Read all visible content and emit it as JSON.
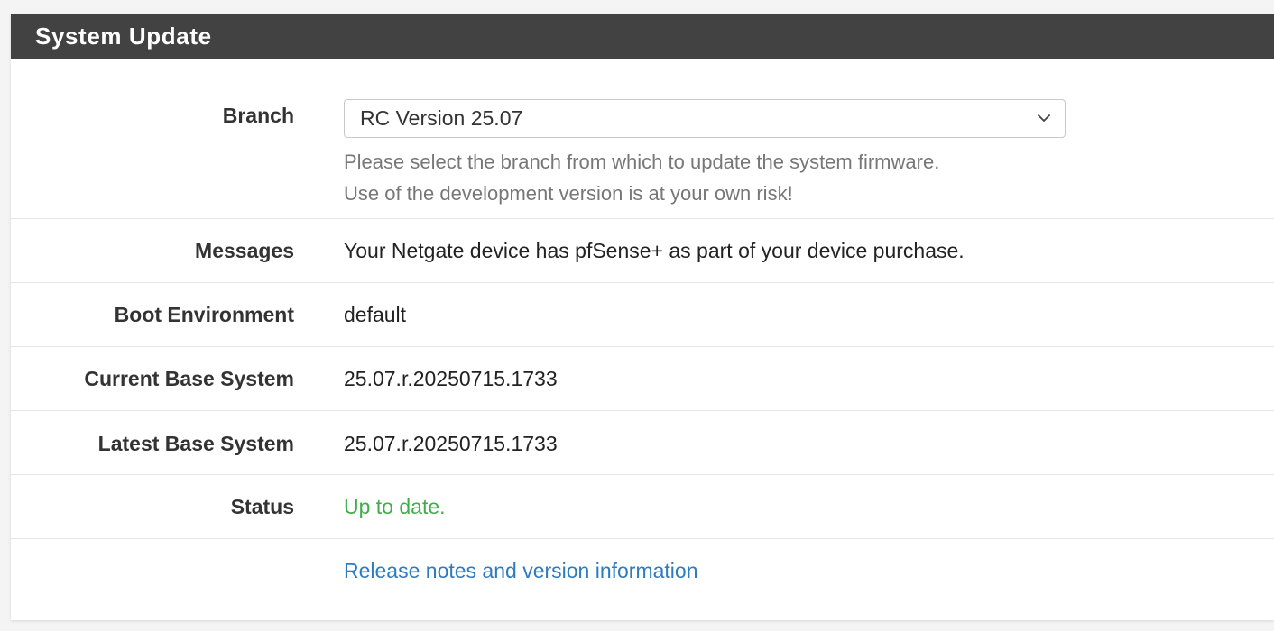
{
  "panel": {
    "title": "System Update"
  },
  "branch": {
    "label": "Branch",
    "selected": "RC Version 25.07",
    "help_line1": "Please select the branch from which to update the system firmware.",
    "help_line2": "Use of the development version is at your own risk!"
  },
  "messages": {
    "label": "Messages",
    "value": "Your Netgate device has pfSense+ as part of your device purchase."
  },
  "boot_environment": {
    "label": "Boot Environment",
    "value": "default"
  },
  "current_base_system": {
    "label": "Current Base System",
    "value": "25.07.r.20250715.1733"
  },
  "latest_base_system": {
    "label": "Latest Base System",
    "value": "25.07.r.20250715.1733"
  },
  "status": {
    "label": "Status",
    "value": "Up to date."
  },
  "release_notes": {
    "link_text": "Release notes and version information"
  },
  "colors": {
    "heading_bg": "#424242",
    "status_ok": "#3fae49",
    "link": "#2e7bbf"
  },
  "icons": {
    "select_arrow": "chevron-down-icon"
  }
}
